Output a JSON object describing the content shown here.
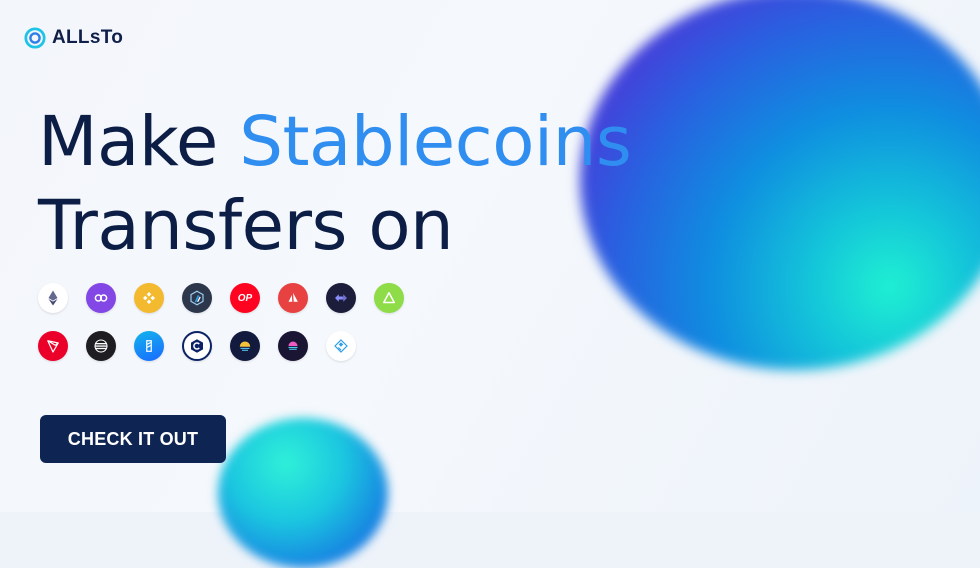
{
  "brand": {
    "name": "ALLsTo",
    "icon": "allsto-logo-icon"
  },
  "headline": {
    "line1_prefix": "Make ",
    "line1_accent": "Stablecoins",
    "line2": "Transfers on"
  },
  "colors": {
    "accent": "#2f8ef0",
    "heading": "#0c1e45",
    "button": "#0e2452"
  },
  "networks": {
    "row1": [
      {
        "icon": "ethereum-icon"
      },
      {
        "icon": "polygon-icon"
      },
      {
        "icon": "bnb-chain-icon"
      },
      {
        "icon": "arbitrum-icon"
      },
      {
        "icon": "optimism-icon",
        "label": "OP"
      },
      {
        "icon": "avalanche-icon"
      },
      {
        "icon": "bridge-arrows-icon"
      },
      {
        "icon": "triangle-network-icon"
      }
    ],
    "row2": [
      {
        "icon": "tron-icon"
      },
      {
        "icon": "aptos-icon"
      },
      {
        "icon": "fantom-icon"
      },
      {
        "icon": "cronos-icon"
      },
      {
        "icon": "sunrise-chain-icon"
      },
      {
        "icon": "sunset-chain-icon"
      },
      {
        "icon": "linea-chain-icon"
      }
    ]
  },
  "cta": {
    "label": "CHECK IT OUT"
  }
}
